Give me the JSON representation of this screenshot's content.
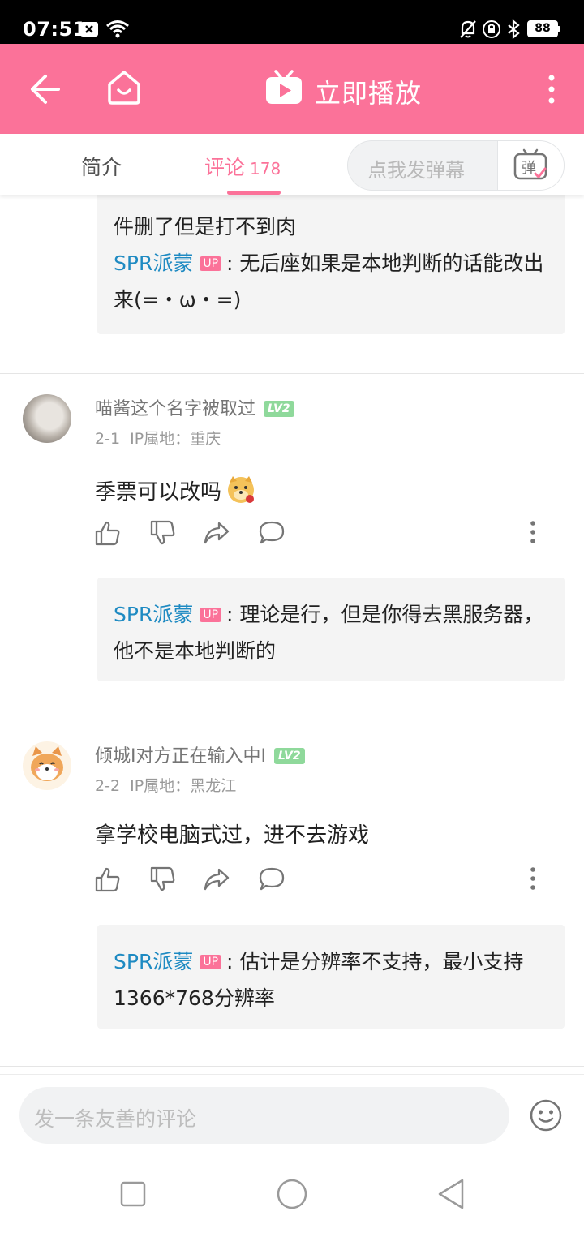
{
  "status": {
    "time": "07:51",
    "battery": "88"
  },
  "header": {
    "title": "立即播放",
    "back_icon": "arrow-left-icon",
    "home_icon": "home-icon",
    "more_icon": "more-vertical-icon"
  },
  "tabs": {
    "intro": "简介",
    "comments": "评论",
    "comments_count": "178",
    "danmaku_placeholder": "点我发弹幕",
    "danmaku_button": "弹"
  },
  "partial": {
    "text_line": "件删了但是打不到肉",
    "reply_user": "SPR派蒙",
    "up_badge": "UP",
    "reply_text": ": 无后座如果是本地判断的话能改出来(=・ω・=)"
  },
  "comments": [
    {
      "user": "喵酱这个名字被取过",
      "level": "LV2",
      "date": "2-1",
      "ip": "IP属地：重庆",
      "text": "季票可以改吗",
      "reply_user": "SPR派蒙",
      "reply_badge": "UP",
      "reply_text": ": 理论是行，但是你得去黑服务器，他不是本地判断的"
    },
    {
      "user": "倾城I对方正在输入中I",
      "level": "LV2",
      "date": "2-2",
      "ip": "IP属地：黑龙江",
      "text": "拿学校电脑式过，进不去游戏",
      "reply_user": "SPR派蒙",
      "reply_badge": "UP",
      "reply_text": ": 估计是分辨率不支持，最小支持1366*768分辨率"
    }
  ],
  "bottom": {
    "comment_placeholder": "发一条友善的评论",
    "emoji_icon": "emoji-icon"
  },
  "colors": {
    "brand_pink": "#fb7299",
    "link_blue": "#1e8ac2",
    "level_green": "#8fd99b"
  }
}
